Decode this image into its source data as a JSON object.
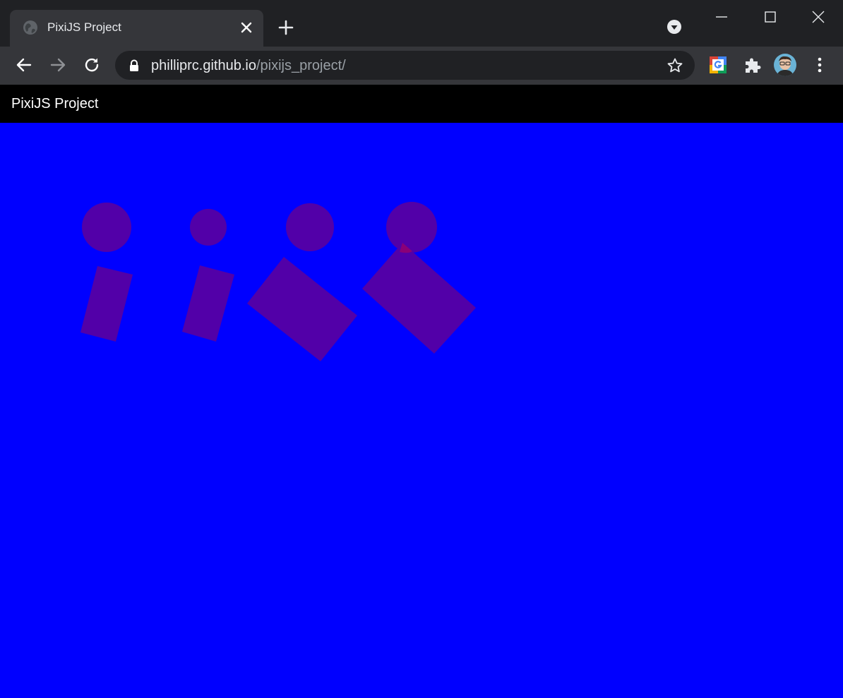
{
  "browser": {
    "tab": {
      "title": "PixiJS Project",
      "favicon": "globe-icon"
    },
    "address": {
      "host": "philliprc.github.io",
      "path": "/pixijs_project/"
    },
    "icons": {
      "close": "close-icon",
      "new_tab": "plus-icon",
      "back": "arrow-left-icon",
      "forward": "arrow-right-icon",
      "reload": "reload-icon",
      "lock": "lock-icon",
      "bookmark": "star-icon",
      "extensions": "puzzle-icon",
      "menu": "kebab-menu-icon"
    }
  },
  "page": {
    "title": "PixiJS Project",
    "colors": {
      "header_bg": "#000000",
      "stage_bg": "#0000ff",
      "shape_fill": "#5200a8",
      "overlap_fill": "#8a0078"
    }
  }
}
